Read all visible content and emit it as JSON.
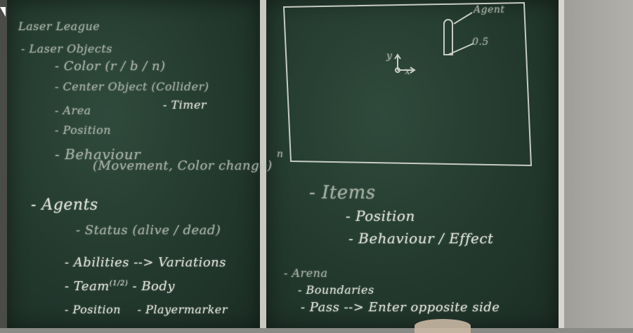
{
  "left_board": {
    "title": "Laser League",
    "laser_objects": "- Laser Objects",
    "color": "- Color (r / b / n)",
    "center_object": "- Center Object (Collider)",
    "area": "- Area",
    "timer": "- Timer",
    "position": "- Position",
    "behaviour": "- Behaviour",
    "behaviour_detail": "(Movement, Color change)",
    "agents": "- Agents",
    "status": "- Status (alive / dead)",
    "abilities": "- Abilities --> Variations",
    "team": "- Team",
    "team_sup": "(1/2)",
    "body": "- Body",
    "agent_position": "- Position",
    "playermarker": "- Playermarker"
  },
  "right_board": {
    "diagram": {
      "agent_label": "Agent",
      "axis_y": "y",
      "axis_x": "x",
      "corner_n": "n",
      "size_label": "0.5"
    },
    "items": "- Items",
    "items_position": "- Position",
    "items_behaviour": "- Behaviour / Effect",
    "arena": "- Arena",
    "boundaries": "- Boundaries",
    "pass": "- Pass --> Enter opposite side"
  }
}
